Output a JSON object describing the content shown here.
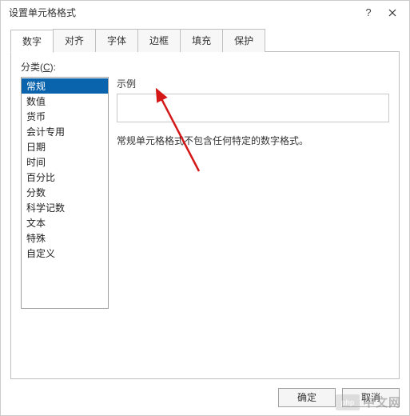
{
  "window": {
    "title": "设置单元格格式",
    "help": "?",
    "close": "×"
  },
  "tabs": [
    {
      "label": "数字",
      "active": true
    },
    {
      "label": "对齐",
      "active": false
    },
    {
      "label": "字体",
      "active": false
    },
    {
      "label": "边框",
      "active": false
    },
    {
      "label": "填充",
      "active": false
    },
    {
      "label": "保护",
      "active": false
    }
  ],
  "category": {
    "label_prefix": "分类(",
    "label_key": "C",
    "label_suffix": "):",
    "items": [
      "常规",
      "数值",
      "货币",
      "会计专用",
      "日期",
      "时间",
      "百分比",
      "分数",
      "科学记数",
      "文本",
      "特殊",
      "自定义"
    ],
    "selected_index": 0
  },
  "example": {
    "label": "示例",
    "value": ""
  },
  "description": "常规单元格格式不包含任何特定的数字格式。",
  "buttons": {
    "ok": "确定",
    "cancel": "取消"
  },
  "watermark": {
    "logo": "php",
    "text": "中文网"
  },
  "annotation": {
    "arrow_color": "#d41818"
  }
}
